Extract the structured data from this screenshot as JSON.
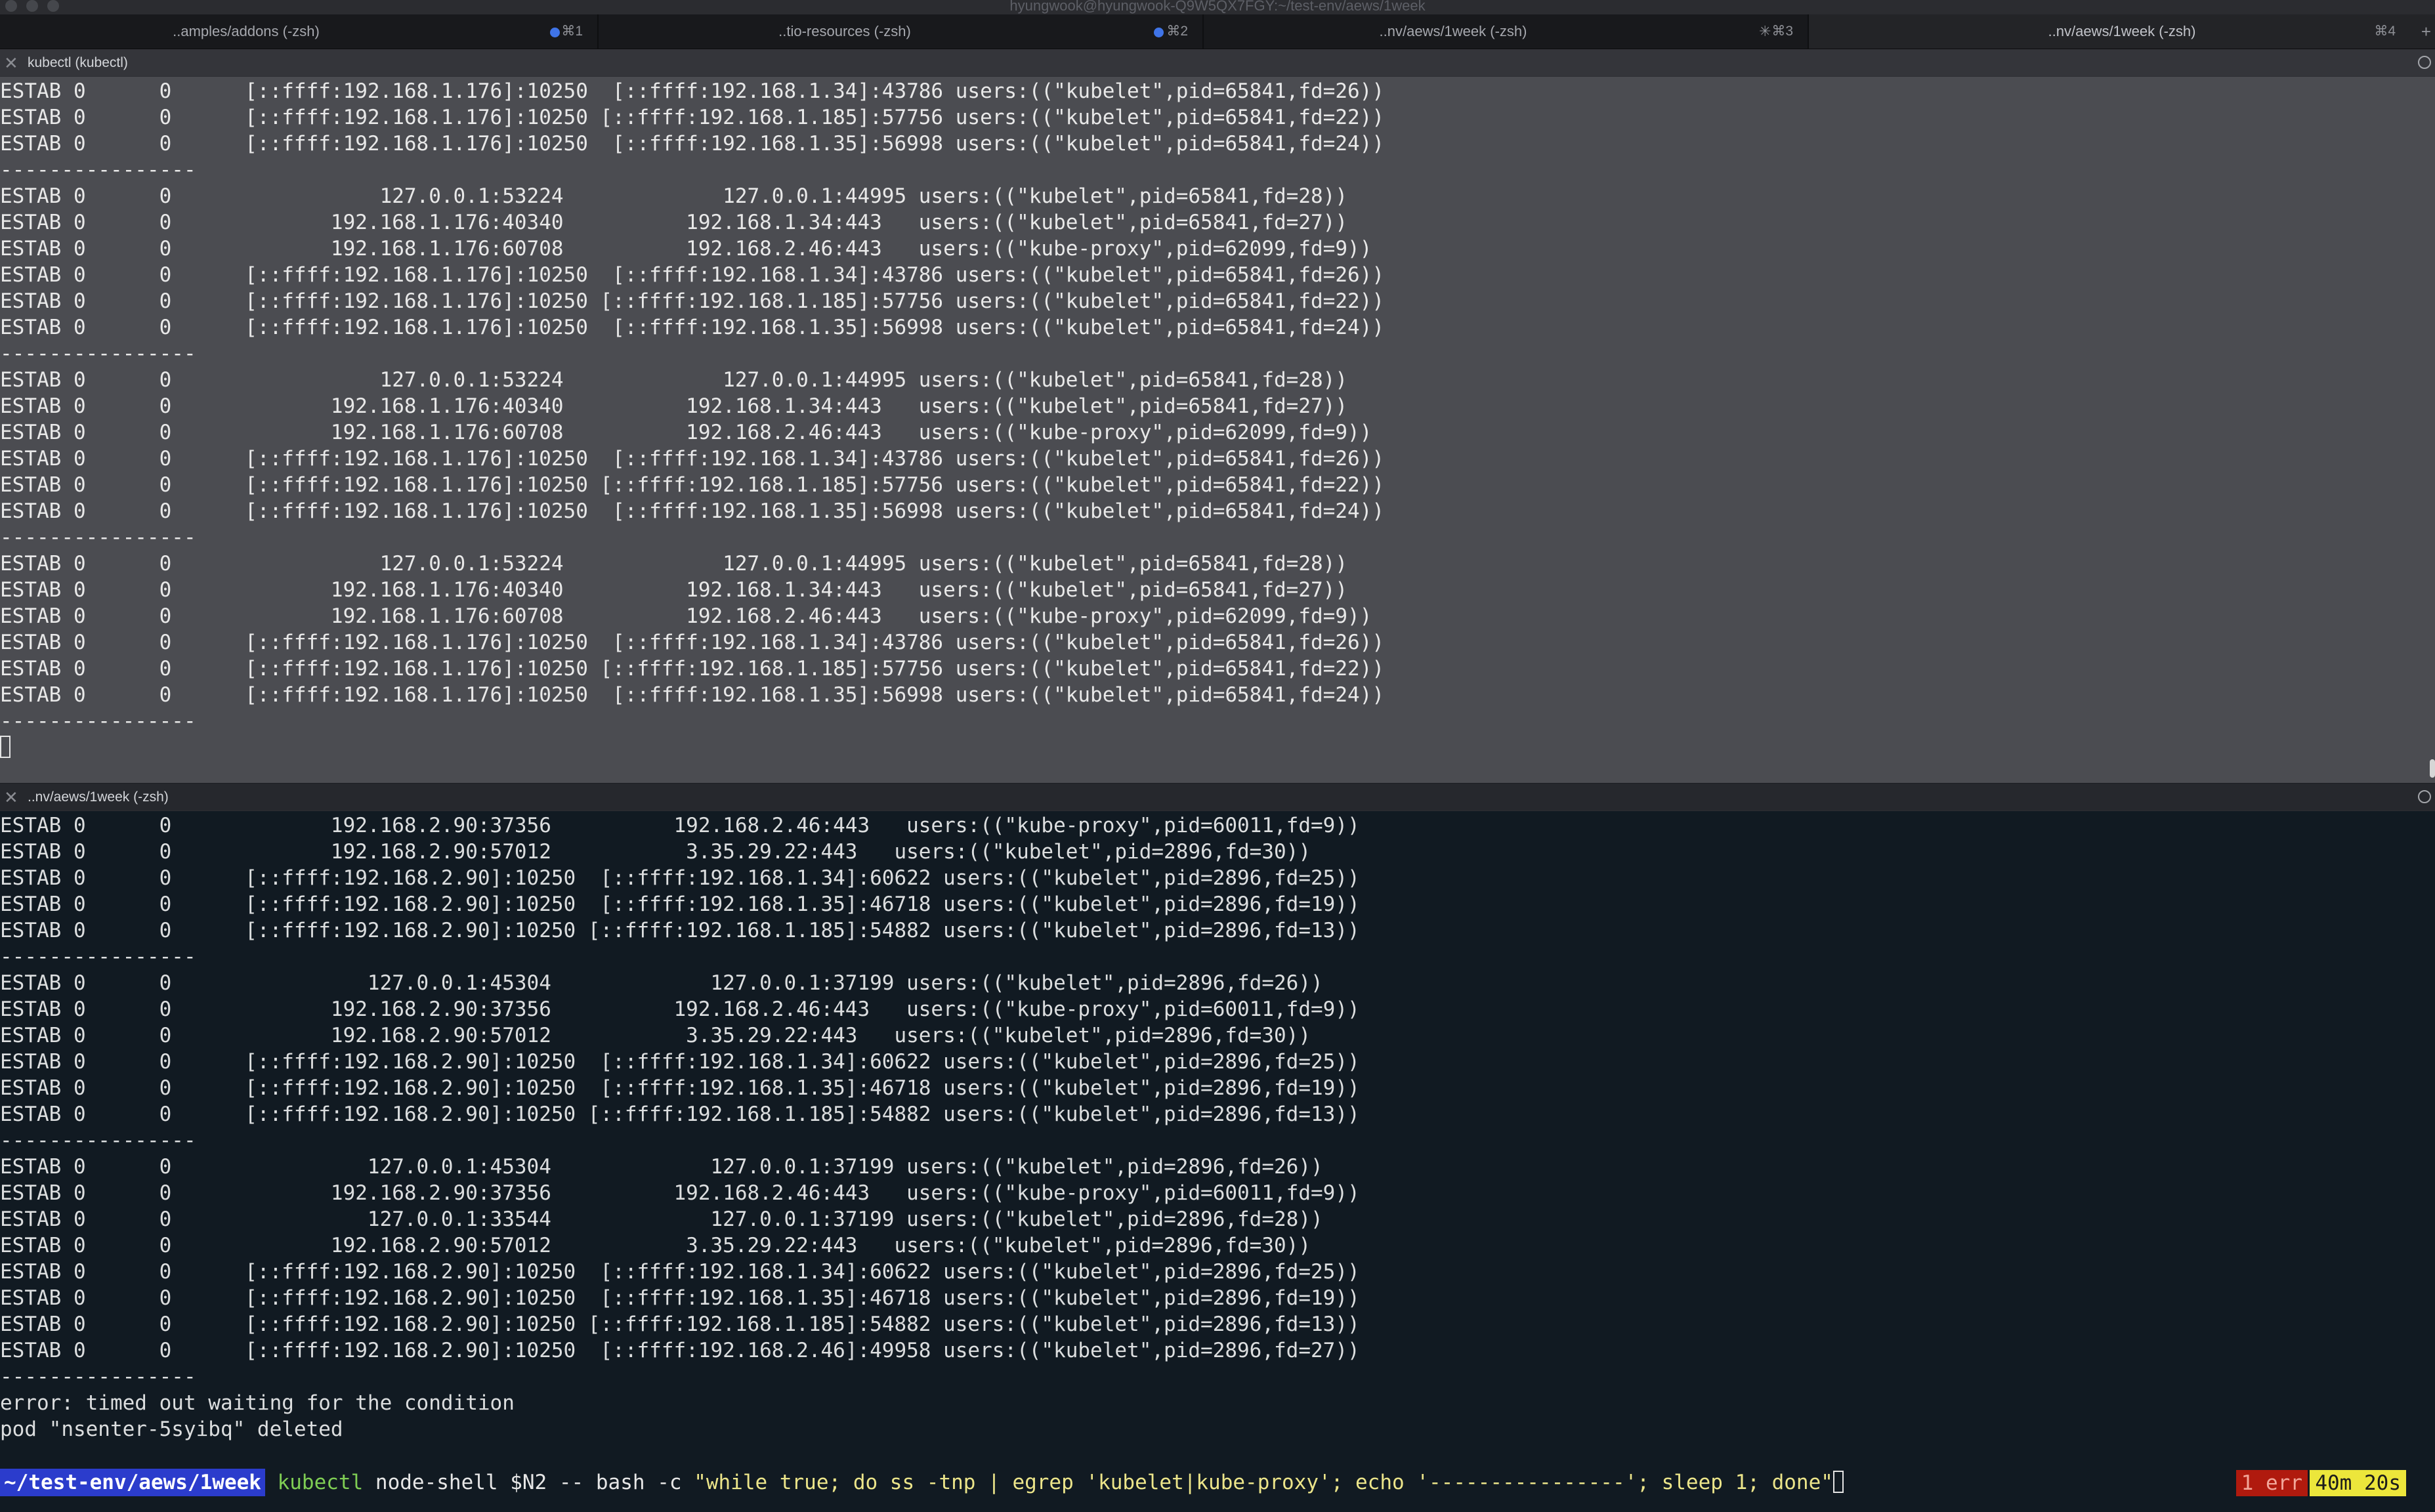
{
  "window": {
    "title": "hyungwook@hyungwook-Q9W5QX7FGY:~/test-env/aews/1week"
  },
  "tabs": [
    {
      "label": "..amples/addons (-zsh)",
      "shortcut": "⌘1",
      "dot": true
    },
    {
      "label": "..tio-resources (-zsh)",
      "shortcut": "⌘2",
      "dot": true
    },
    {
      "label": "..nv/aews/1week (-zsh)",
      "shortcut": "⌘3",
      "dot": false
    },
    {
      "label": "..nv/aews/1week (-zsh)",
      "shortcut": "⌘4",
      "dot": false
    }
  ],
  "pane1": {
    "title": "kubectl (kubectl)",
    "lines": [
      "ESTAB 0      0      [::ffff:192.168.1.176]:10250  [::ffff:192.168.1.34]:43786 users:((\"kubelet\",pid=65841,fd=26))",
      "ESTAB 0      0      [::ffff:192.168.1.176]:10250 [::ffff:192.168.1.185]:57756 users:((\"kubelet\",pid=65841,fd=22))",
      "ESTAB 0      0      [::ffff:192.168.1.176]:10250  [::ffff:192.168.1.35]:56998 users:((\"kubelet\",pid=65841,fd=24))",
      "----------------",
      "ESTAB 0      0                 127.0.0.1:53224             127.0.0.1:44995 users:((\"kubelet\",pid=65841,fd=28))",
      "ESTAB 0      0             192.168.1.176:40340          192.168.1.34:443   users:((\"kubelet\",pid=65841,fd=27))",
      "ESTAB 0      0             192.168.1.176:60708          192.168.2.46:443   users:((\"kube-proxy\",pid=62099,fd=9))",
      "ESTAB 0      0      [::ffff:192.168.1.176]:10250  [::ffff:192.168.1.34]:43786 users:((\"kubelet\",pid=65841,fd=26))",
      "ESTAB 0      0      [::ffff:192.168.1.176]:10250 [::ffff:192.168.1.185]:57756 users:((\"kubelet\",pid=65841,fd=22))",
      "ESTAB 0      0      [::ffff:192.168.1.176]:10250  [::ffff:192.168.1.35]:56998 users:((\"kubelet\",pid=65841,fd=24))",
      "----------------",
      "ESTAB 0      0                 127.0.0.1:53224             127.0.0.1:44995 users:((\"kubelet\",pid=65841,fd=28))",
      "ESTAB 0      0             192.168.1.176:40340          192.168.1.34:443   users:((\"kubelet\",pid=65841,fd=27))",
      "ESTAB 0      0             192.168.1.176:60708          192.168.2.46:443   users:((\"kube-proxy\",pid=62099,fd=9))",
      "ESTAB 0      0      [::ffff:192.168.1.176]:10250  [::ffff:192.168.1.34]:43786 users:((\"kubelet\",pid=65841,fd=26))",
      "ESTAB 0      0      [::ffff:192.168.1.176]:10250 [::ffff:192.168.1.185]:57756 users:((\"kubelet\",pid=65841,fd=22))",
      "ESTAB 0      0      [::ffff:192.168.1.176]:10250  [::ffff:192.168.1.35]:56998 users:((\"kubelet\",pid=65841,fd=24))",
      "----------------",
      "ESTAB 0      0                 127.0.0.1:53224             127.0.0.1:44995 users:((\"kubelet\",pid=65841,fd=28))",
      "ESTAB 0      0             192.168.1.176:40340          192.168.1.34:443   users:((\"kubelet\",pid=65841,fd=27))",
      "ESTAB 0      0             192.168.1.176:60708          192.168.2.46:443   users:((\"kube-proxy\",pid=62099,fd=9))",
      "ESTAB 0      0      [::ffff:192.168.1.176]:10250  [::ffff:192.168.1.34]:43786 users:((\"kubelet\",pid=65841,fd=26))",
      "ESTAB 0      0      [::ffff:192.168.1.176]:10250 [::ffff:192.168.1.185]:57756 users:((\"kubelet\",pid=65841,fd=22))",
      "ESTAB 0      0      [::ffff:192.168.1.176]:10250  [::ffff:192.168.1.35]:56998 users:((\"kubelet\",pid=65841,fd=24))",
      "----------------"
    ]
  },
  "pane2": {
    "title": "..nv/aews/1week (-zsh)",
    "lines": [
      "ESTAB 0      0             192.168.2.90:37356          192.168.2.46:443   users:((\"kube-proxy\",pid=60011,fd=9))",
      "ESTAB 0      0             192.168.2.90:57012           3.35.29.22:443   users:((\"kubelet\",pid=2896,fd=30))",
      "ESTAB 0      0      [::ffff:192.168.2.90]:10250  [::ffff:192.168.1.34]:60622 users:((\"kubelet\",pid=2896,fd=25))",
      "ESTAB 0      0      [::ffff:192.168.2.90]:10250  [::ffff:192.168.1.35]:46718 users:((\"kubelet\",pid=2896,fd=19))",
      "ESTAB 0      0      [::ffff:192.168.2.90]:10250 [::ffff:192.168.1.185]:54882 users:((\"kubelet\",pid=2896,fd=13))",
      "----------------",
      "ESTAB 0      0                127.0.0.1:45304             127.0.0.1:37199 users:((\"kubelet\",pid=2896,fd=26))",
      "ESTAB 0      0             192.168.2.90:37356          192.168.2.46:443   users:((\"kube-proxy\",pid=60011,fd=9))",
      "ESTAB 0      0             192.168.2.90:57012           3.35.29.22:443   users:((\"kubelet\",pid=2896,fd=30))",
      "ESTAB 0      0      [::ffff:192.168.2.90]:10250  [::ffff:192.168.1.34]:60622 users:((\"kubelet\",pid=2896,fd=25))",
      "ESTAB 0      0      [::ffff:192.168.2.90]:10250  [::ffff:192.168.1.35]:46718 users:((\"kubelet\",pid=2896,fd=19))",
      "ESTAB 0      0      [::ffff:192.168.2.90]:10250 [::ffff:192.168.1.185]:54882 users:((\"kubelet\",pid=2896,fd=13))",
      "----------------",
      "ESTAB 0      0                127.0.0.1:45304             127.0.0.1:37199 users:((\"kubelet\",pid=2896,fd=26))",
      "ESTAB 0      0             192.168.2.90:37356          192.168.2.46:443   users:((\"kube-proxy\",pid=60011,fd=9))",
      "ESTAB 0      0                127.0.0.1:33544             127.0.0.1:37199 users:((\"kubelet\",pid=2896,fd=28))",
      "ESTAB 0      0             192.168.2.90:57012           3.35.29.22:443   users:((\"kubelet\",pid=2896,fd=30))",
      "ESTAB 0      0      [::ffff:192.168.2.90]:10250  [::ffff:192.168.1.34]:60622 users:((\"kubelet\",pid=2896,fd=25))",
      "ESTAB 0      0      [::ffff:192.168.2.90]:10250  [::ffff:192.168.1.35]:46718 users:((\"kubelet\",pid=2896,fd=19))",
      "ESTAB 0      0      [::ffff:192.168.2.90]:10250 [::ffff:192.168.1.185]:54882 users:((\"kubelet\",pid=2896,fd=13))",
      "ESTAB 0      0      [::ffff:192.168.2.90]:10250  [::ffff:192.168.2.46]:49958 users:((\"kubelet\",pid=2896,fd=27))",
      "----------------",
      "error: timed out waiting for the condition",
      "pod \"nsenter-5syibq\" deleted"
    ]
  },
  "prompt": {
    "dir": "~/test-env/aews/1week",
    "cmd": "kubectl",
    "args": " node-shell $N2 -- bash -c ",
    "str": "\"while true; do ss -tnp | egrep 'kubelet|kube-proxy'; echo '----------------'; sleep 1; done\""
  },
  "status": {
    "errors": "1 err",
    "elapsed": "40m 20s"
  },
  "colors": {
    "pane1_bg": "#4b4c51",
    "pane2_bg": "#111a22",
    "prompt_dir_bg": "#2b3ccc",
    "command": "#7fce54",
    "string": "#ece58a",
    "error_badge": "#b01a0e",
    "time_badge": "#ece63b"
  },
  "icons": {
    "pane_close": "close-icon",
    "pane_menu": "menu-circle-icon",
    "tab_activity": "activity-dot-icon",
    "tab_busy": "spinner-icon"
  }
}
